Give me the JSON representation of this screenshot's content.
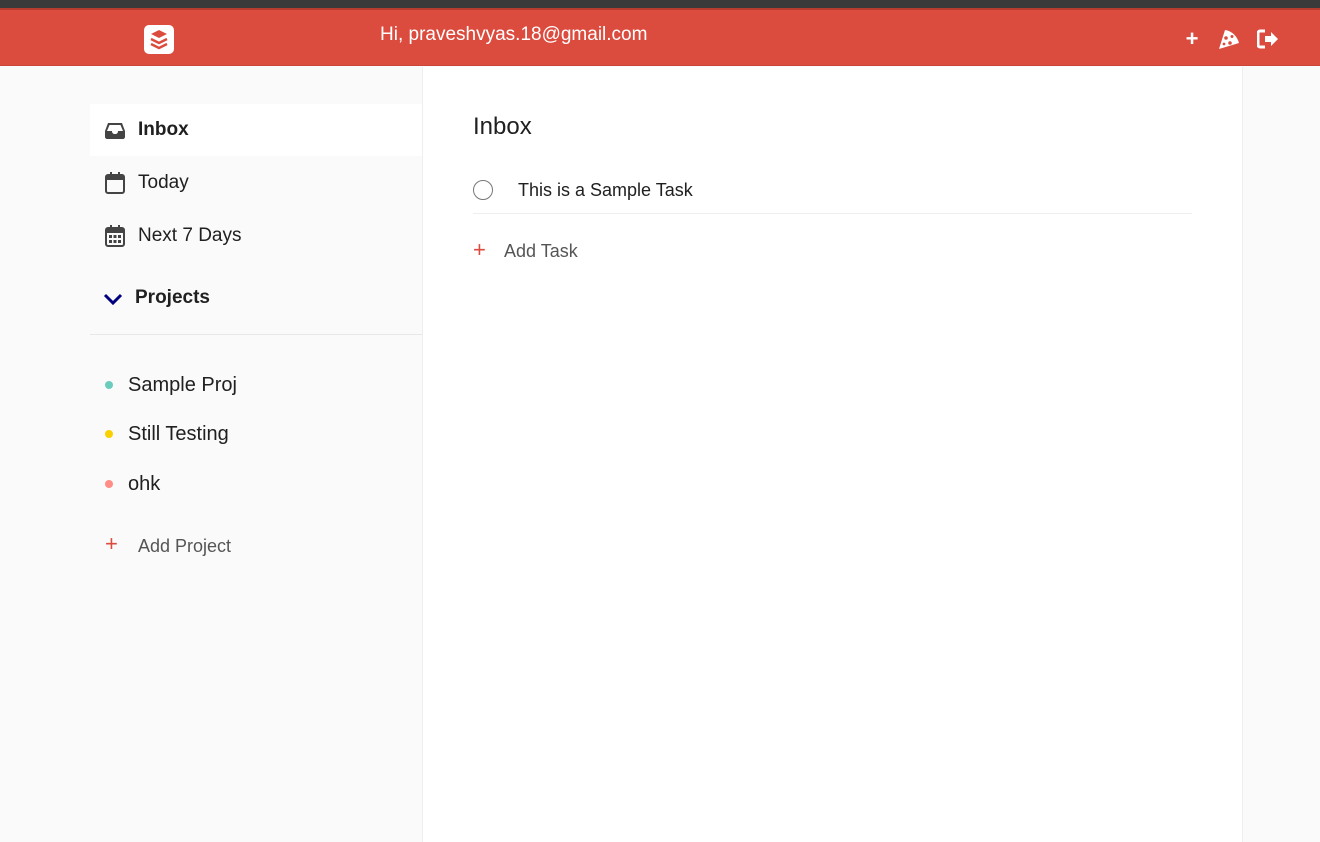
{
  "header": {
    "greeting": "Hi, praveshvyas.18@gmail.com",
    "add_symbol": "+",
    "logo_icon": "todoist-logo-icon",
    "pizza_icon": "pizza-icon",
    "logout_icon": "logout-icon"
  },
  "sidebar": {
    "nav": [
      {
        "label": "Inbox",
        "icon": "inbox-icon",
        "active": true
      },
      {
        "label": "Today",
        "icon": "calendar-icon",
        "active": false
      },
      {
        "label": "Next 7 Days",
        "icon": "calendar-week-icon",
        "active": false
      }
    ],
    "projects_header": "Projects",
    "projects": [
      {
        "label": "Sample Proj",
        "color": "#6accbc"
      },
      {
        "label": "Still Testing",
        "color": "#fad000"
      },
      {
        "label": "ohk",
        "color": "#ff8d85"
      }
    ],
    "add_project": {
      "symbol": "+",
      "label": "Add Project"
    }
  },
  "main": {
    "title": "Inbox",
    "tasks": [
      {
        "text": "This is a Sample Task"
      }
    ],
    "add_task": {
      "symbol": "+",
      "label": "Add Task"
    }
  },
  "colors": {
    "brand": "#db4c3f",
    "chevron": "#000080"
  }
}
